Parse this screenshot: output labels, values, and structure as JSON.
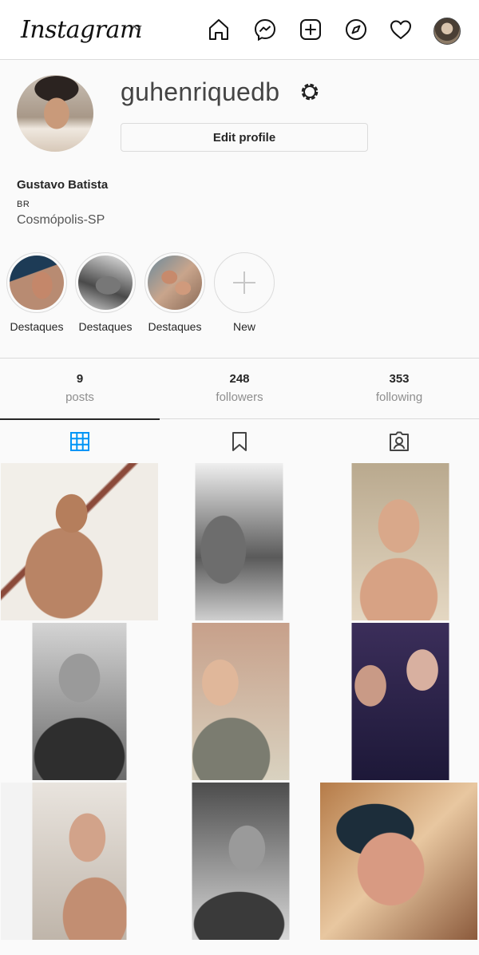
{
  "nav": {
    "logo": "Instagram",
    "icons": [
      "home-icon",
      "messenger-icon",
      "new-post-icon",
      "explore-icon",
      "activity-heart-icon",
      "profile-avatar-icon"
    ]
  },
  "profile": {
    "username": "guhenriquedb",
    "edit_button": "Edit profile",
    "full_name": "Gustavo Batista",
    "bio_line1": "BR",
    "bio_line2": "Cosmópolis-SP"
  },
  "highlights": [
    {
      "label": "Destaques"
    },
    {
      "label": "Destaques"
    },
    {
      "label": "Destaques"
    },
    {
      "label": "New"
    }
  ],
  "stats": {
    "posts": {
      "count": "9",
      "label": "posts"
    },
    "followers": {
      "count": "248",
      "label": "followers"
    },
    "following": {
      "count": "353",
      "label": "following"
    }
  },
  "tabs": [
    "posts-grid-icon",
    "saved-icon",
    "tagged-icon"
  ],
  "colors": {
    "active_tab": "#0095f6",
    "text": "#262626",
    "muted": "#8e8e8e",
    "border": "#dbdbdb"
  }
}
